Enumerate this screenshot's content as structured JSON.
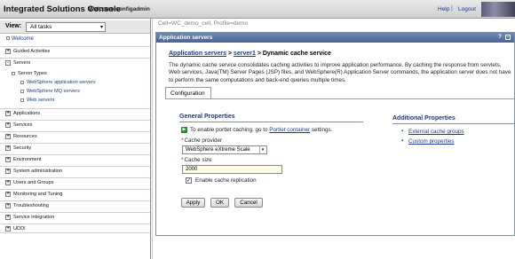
{
  "banner": {
    "brand": "Integrated Solutions Console",
    "welcome": "Welcome configadmin",
    "help": "Help",
    "separator": "|",
    "logout": "Logout"
  },
  "nav": {
    "view_label": "View:",
    "view_value": "All tasks",
    "welcome": "Welcome",
    "sections": [
      {
        "label": "Guided Activities",
        "state": "+"
      },
      {
        "label": "Servers",
        "state": "-"
      },
      {
        "label": "Applications",
        "state": "+"
      },
      {
        "label": "Services",
        "state": "+"
      },
      {
        "label": "Resources",
        "state": "+"
      },
      {
        "label": "Security",
        "state": "+"
      },
      {
        "label": "Environment",
        "state": "+"
      },
      {
        "label": "System administration",
        "state": "+"
      },
      {
        "label": "Users and Groups",
        "state": "+"
      },
      {
        "label": "Monitoring and Tuning",
        "state": "+"
      },
      {
        "label": "Troubleshooting",
        "state": "+"
      },
      {
        "label": "Service integration",
        "state": "+"
      },
      {
        "label": "UDDI",
        "state": "+"
      }
    ],
    "server_types": "Server Types",
    "server_links": [
      "WebSphere application servers",
      "WebSphere MQ servers",
      "Web servers"
    ]
  },
  "main": {
    "cell_info": "Cell=WC_demo_cell, Profile=demo",
    "panel_title": "Application servers",
    "help_marker": "?",
    "breadcrumb": {
      "part1": "Application servers",
      "sep1": " > ",
      "part2": "server1",
      "sep2": " > ",
      "current": "Dynamic cache service"
    },
    "description": "The dynamic cache service consolidates caching activities to improve application performance. By caching the response from servlets, Web services, Java(TM) Server Pages (JSP) files, and WebSphere(R) Application Server commands, the application server does not have to perform the same computations and back-end queries multiple times.",
    "tab": "Configuration",
    "general_properties": "General Properties",
    "info_prefix": "To enable portlet caching, go to ",
    "info_link": "Portlet container",
    "info_suffix": " settings.",
    "cache_provider_label": "Cache provider",
    "cache_provider_value": "WebSphere eXtreme Scale",
    "cache_size_label": "Cache size",
    "cache_size_value": "2000",
    "enable_replication": "Enable cache replication",
    "enable_replication_checked": true,
    "buttons": {
      "apply": "Apply",
      "ok": "OK",
      "cancel": "Cancel"
    },
    "additional_properties": "Additional Properties",
    "additional_links": [
      "External cache groups",
      "Custom properties"
    ]
  }
}
